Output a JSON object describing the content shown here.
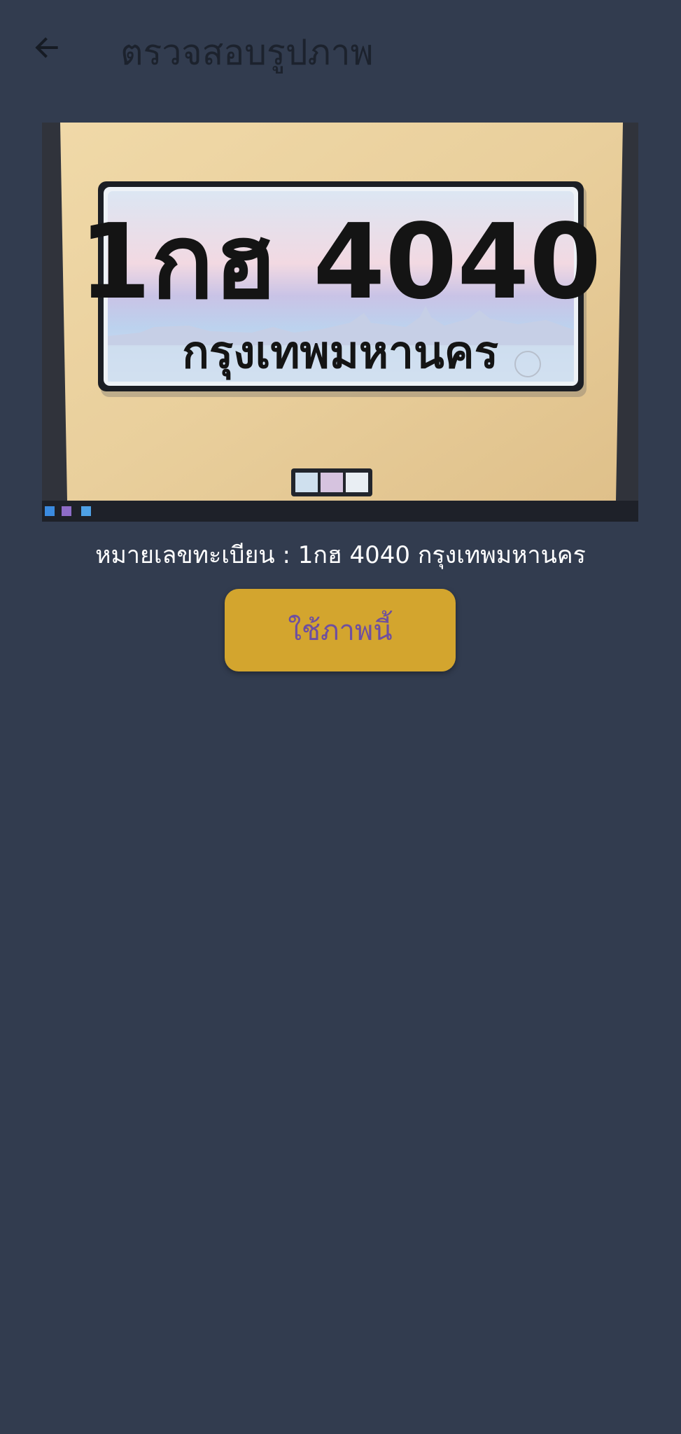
{
  "header": {
    "title": "ตรวจสอบรูปภาพ",
    "back_icon": "arrow-left-icon"
  },
  "photo": {
    "plate_number": "1กฮ 4040",
    "plate_province": "กรุงเทพมหานคร"
  },
  "result": {
    "caption": "หมายเลขทะเบียน : 1กฮ 4040 กรุงเทพมหานคร"
  },
  "actions": {
    "use_photo_label": "ใช้ภาพนี้"
  },
  "colors": {
    "background": "#323c4f",
    "title_text": "#1c222d",
    "button_bg": "#d3a52e",
    "button_text": "#6e4fa0"
  }
}
